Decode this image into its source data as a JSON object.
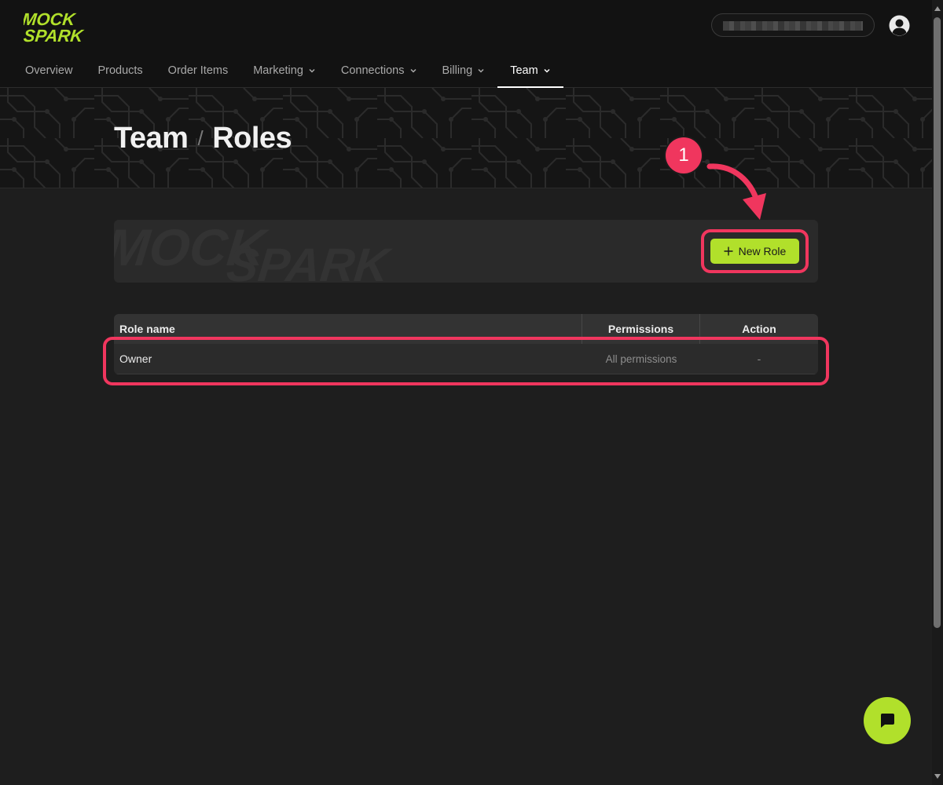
{
  "app": {
    "logo_text": [
      "MOCK",
      "SPARK"
    ],
    "accent_color": "#b1e02b",
    "highlight_color": "#f0365e"
  },
  "header": {
    "search_value_obscured": true,
    "account_icon": "account-circle-icon"
  },
  "nav": {
    "items": [
      {
        "label": "Overview",
        "dropdown": false,
        "active": false
      },
      {
        "label": "Products",
        "dropdown": false,
        "active": false
      },
      {
        "label": "Order Items",
        "dropdown": false,
        "active": false
      },
      {
        "label": "Marketing",
        "dropdown": true,
        "active": false
      },
      {
        "label": "Connections",
        "dropdown": true,
        "active": false
      },
      {
        "label": "Billing",
        "dropdown": true,
        "active": false
      },
      {
        "label": "Team",
        "dropdown": true,
        "active": true
      }
    ]
  },
  "page": {
    "breadcrumb_parent": "Team",
    "breadcrumb_separator": "/",
    "breadcrumb_current": "Roles"
  },
  "actions": {
    "new_role_label": "New Role",
    "new_role_icon": "plus-icon"
  },
  "table": {
    "columns": [
      "Role name",
      "Permissions",
      "Action"
    ],
    "rows": [
      {
        "role_name": "Owner",
        "permissions": "All permissions",
        "action": "-"
      }
    ]
  },
  "annotation": {
    "step_number": "1"
  },
  "chat": {
    "icon": "chat-bubble-icon"
  }
}
